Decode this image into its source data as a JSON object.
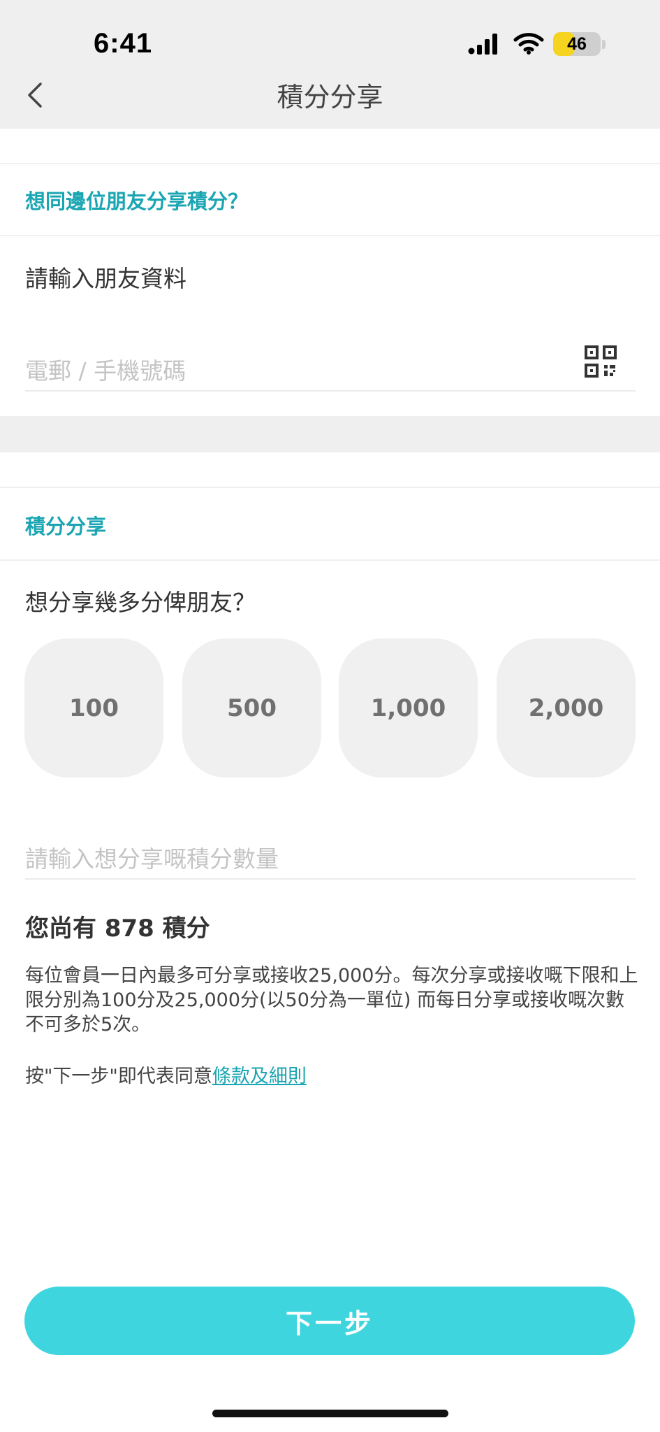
{
  "status_bar": {
    "time": "6:41",
    "battery_level": "46",
    "battery_fraction": 0.46,
    "signal_icon": "cellular-signal-icon",
    "wifi_icon": "wifi-icon"
  },
  "nav": {
    "back_icon": "chevron-left-icon",
    "title": "積分分享"
  },
  "friend_section": {
    "title": "想同邊位朋友分享積分？",
    "prompt": "請輸入朋友資料",
    "contact_value": "",
    "contact_placeholder": "電郵 / 手機號碼",
    "scan_icon": "qr-code-icon"
  },
  "share_section": {
    "title": "積分分享",
    "prompt": "想分享幾多分俾朋友？",
    "amount_options": [
      "100",
      "500",
      "1,000",
      "2,000"
    ],
    "amount_value": "",
    "amount_placeholder": "請輸入想分享嘅積分數量"
  },
  "balance": {
    "prefix": "您尚有 ",
    "points": "878",
    "suffix": " 積分"
  },
  "rules": "每位會員一日內最多可分享或接收25,000分。每次分享或接收嘅下限和上限分別為100分及25,000分(以50分為一單位) 而每日分享或接收嘅次數不可多於5次。",
  "agreement": {
    "prefix": "按\"下一步\"即代表同意",
    "link_text": "條款及細則"
  },
  "next_button": "下一步",
  "colors": {
    "accent": "#1aa5b2",
    "button": "#3fd5df",
    "header_bg": "#efefef",
    "option_bg": "#f0f0f0",
    "battery": "#f5d31f"
  }
}
